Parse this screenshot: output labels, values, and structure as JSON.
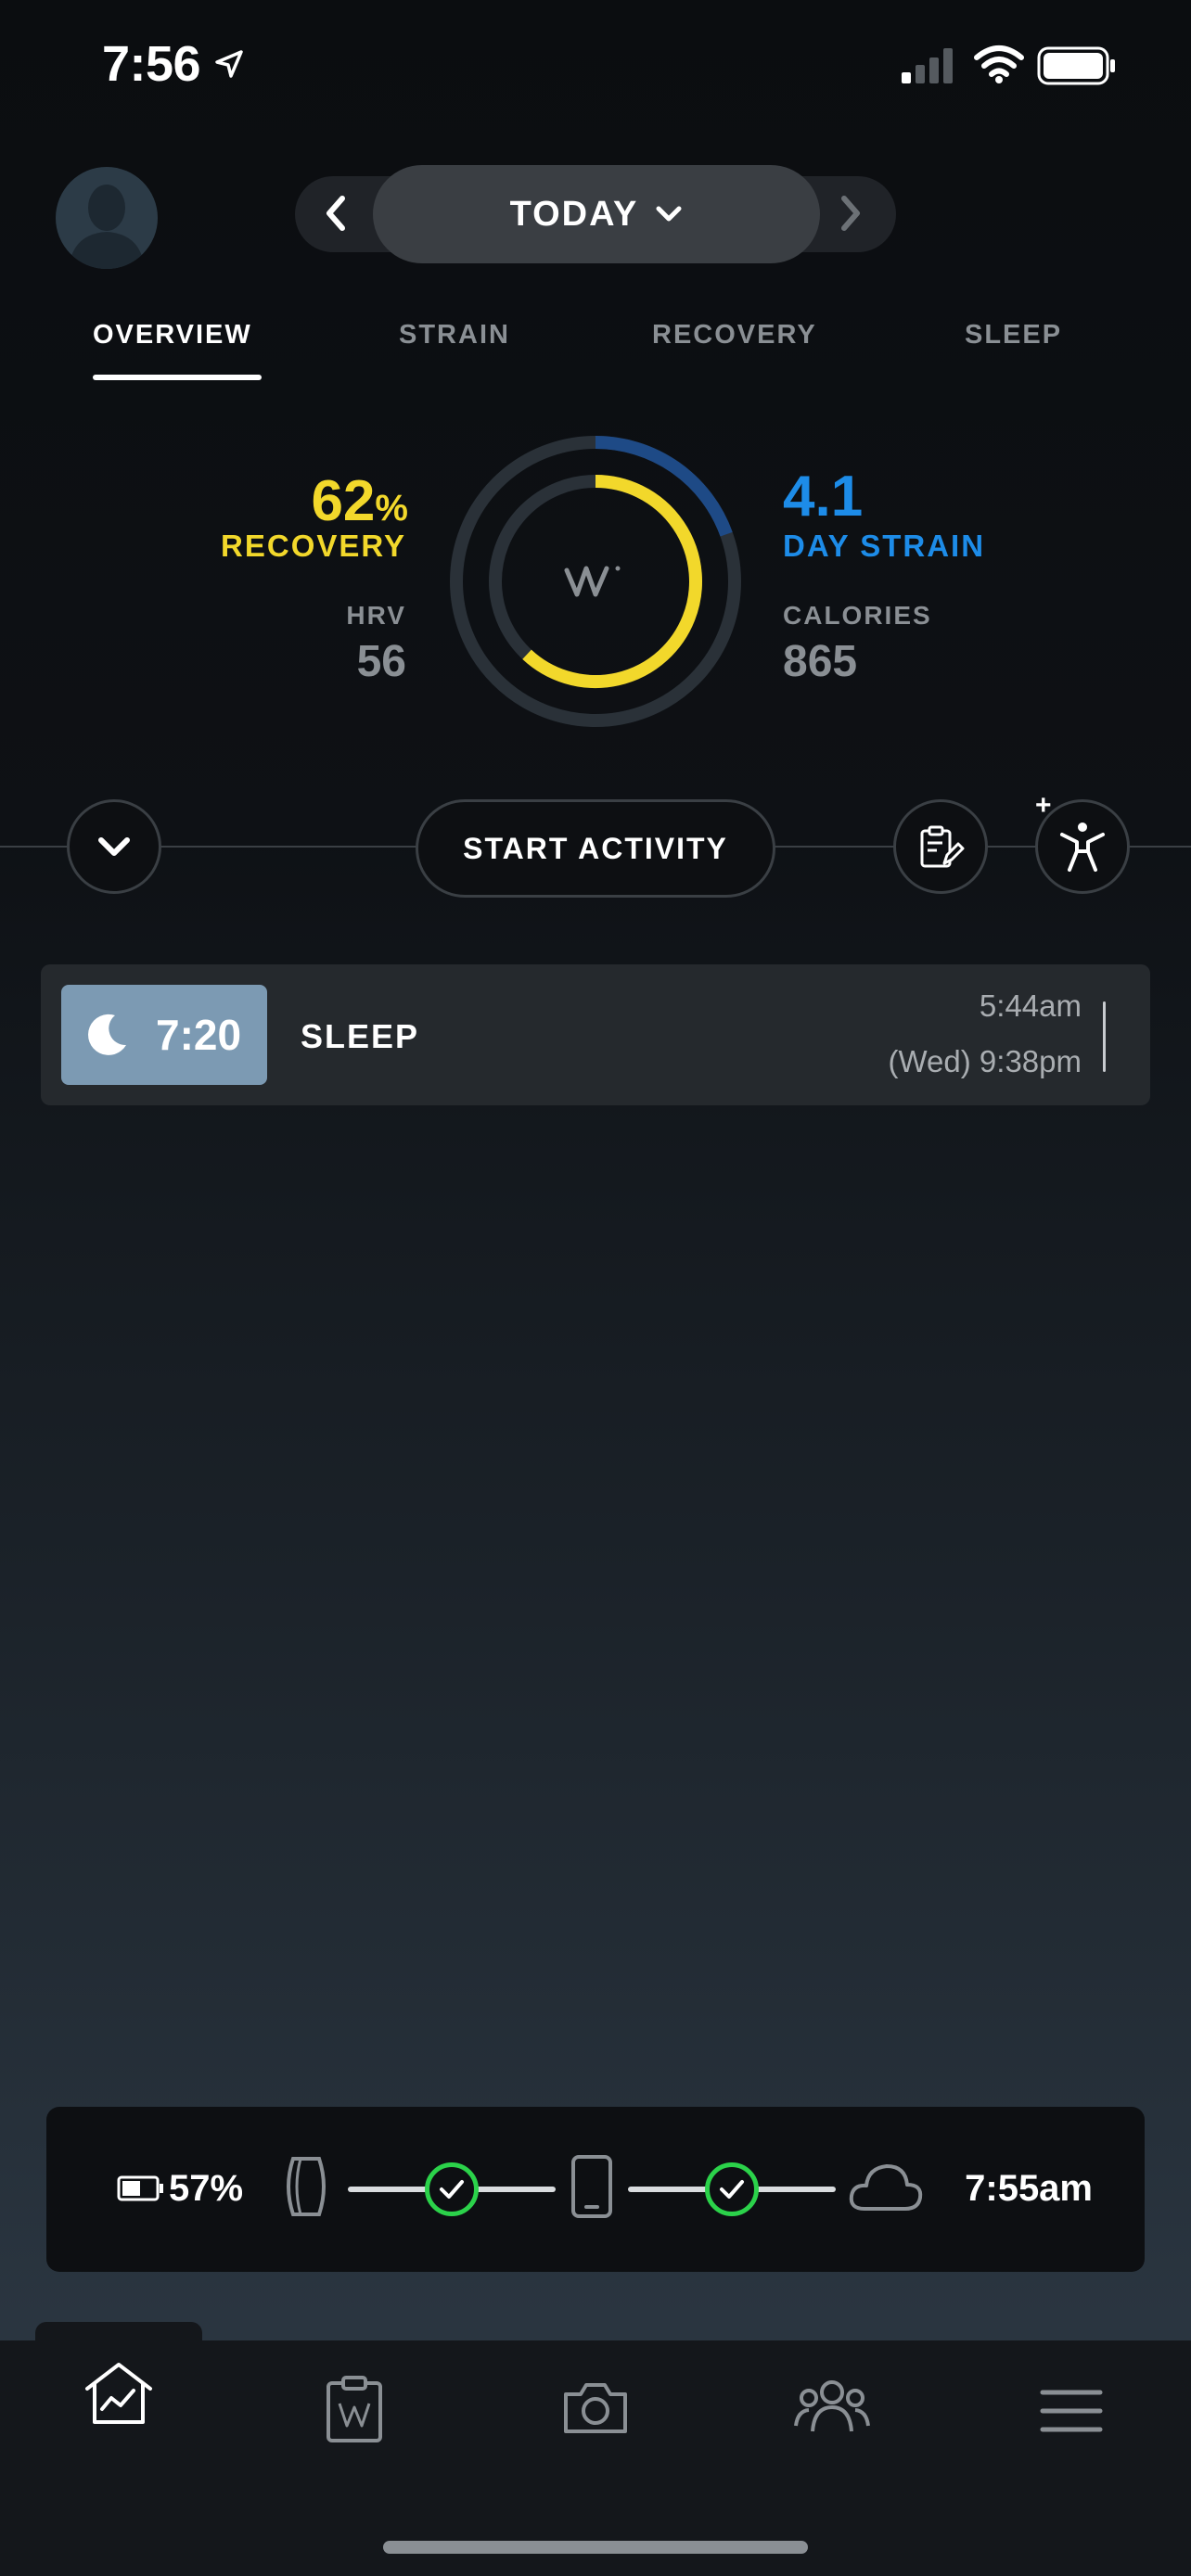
{
  "status_bar": {
    "time": "7:56",
    "icons": [
      "location-arrow-icon",
      "cellular-signal-icon",
      "wifi-icon",
      "battery-icon"
    ]
  },
  "header": {
    "date_label": "TODAY",
    "icons": [
      "avatar",
      "chevron-left-icon",
      "chevron-down-icon",
      "chevron-right-icon"
    ]
  },
  "tabs": [
    {
      "label": "OVERVIEW",
      "active": true
    },
    {
      "label": "STRAIN",
      "active": false
    },
    {
      "label": "RECOVERY",
      "active": false
    },
    {
      "label": "SLEEP",
      "active": false
    }
  ],
  "overview": {
    "recovery_value": "62",
    "recovery_unit": "%",
    "recovery_label": "RECOVERY",
    "hrv_label": "HRV",
    "hrv_value": "56",
    "strain_value": "4.1",
    "strain_label": "DAY STRAIN",
    "calories_label": "CALORIES",
    "calories_value": "865",
    "recovery_fraction": 0.62,
    "strain_fraction": 0.195,
    "colors": {
      "recovery": "#f2d82b",
      "strain": "#1d8ce8",
      "strain_ring": "#1e4a86",
      "track": "#2a3138"
    }
  },
  "actions": {
    "start_activity_label": "START ACTIVITY",
    "add_marker": "+"
  },
  "sleep_card": {
    "duration": "7:20",
    "title": "SLEEP",
    "end_time": "5:44am",
    "start_time": "(Wed) 9:38pm",
    "badge_color": "#7c9ab3"
  },
  "sync_bar": {
    "battery_pct": "57%",
    "battery_fraction": 0.57,
    "last_sync": "7:55am",
    "status_color": "#2bd24a"
  },
  "bottom_nav": {
    "items": [
      "home-icon",
      "journal-icon",
      "camera-icon",
      "community-icon",
      "menu-icon"
    ]
  }
}
